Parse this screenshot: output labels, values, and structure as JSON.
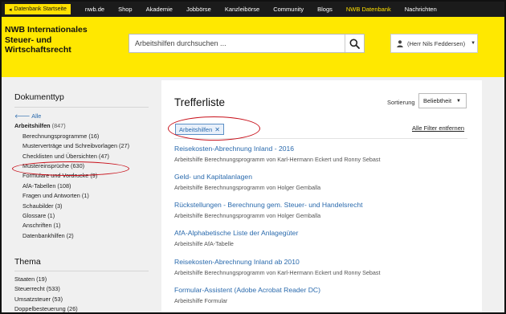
{
  "topnav": {
    "back_label": "Datenbank Startseite",
    "links": [
      {
        "label": "nwb.de",
        "active": false
      },
      {
        "label": "Shop",
        "active": false
      },
      {
        "label": "Akademie",
        "active": false
      },
      {
        "label": "Jobbörse",
        "active": false
      },
      {
        "label": "Kanzleibörse",
        "active": false
      },
      {
        "label": "Community",
        "active": false
      },
      {
        "label": "Blogs",
        "active": false
      },
      {
        "label": "NWB Datenbank",
        "active": true
      },
      {
        "label": "Nachrichten",
        "active": false
      }
    ]
  },
  "header": {
    "brand_line1": "NWB Internationales",
    "brand_line2": "Steuer- und",
    "brand_line3": "Wirtschaftsrecht",
    "search_placeholder": "Arbeitshilfen durchsuchen ...",
    "user_label": "(Herr Nils Feddersen)"
  },
  "sidebar": {
    "doc_title": "Dokumenttyp",
    "doc_items": [
      {
        "label": "Alle",
        "kind": "all"
      },
      {
        "label": "Arbeitshilfen",
        "count": "(847)",
        "kind": "bold"
      },
      {
        "label": "Berechnungsprogramme (16)",
        "kind": "sub"
      },
      {
        "label": "Musterverträge und Schreibvorlagen (27)",
        "kind": "sub"
      },
      {
        "label": "Checklisten und Übersichten (47)",
        "kind": "sub"
      },
      {
        "label": "Mustereinsprüche (630)",
        "kind": "sub"
      },
      {
        "label": "Formulare und Vordrucke (9)",
        "kind": "sub"
      },
      {
        "label": "AfA-Tabellen (108)",
        "kind": "sub"
      },
      {
        "label": "Fragen und Antworten (1)",
        "kind": "sub"
      },
      {
        "label": "Schaubilder (3)",
        "kind": "sub"
      },
      {
        "label": "Glossare (1)",
        "kind": "sub"
      },
      {
        "label": "Anschriften (1)",
        "kind": "sub"
      },
      {
        "label": "Datenbankhilfen (2)",
        "kind": "sub"
      }
    ],
    "thema_title": "Thema",
    "thema_items": [
      {
        "label": "Staaten (19)"
      },
      {
        "label": "Steuerrecht (533)"
      },
      {
        "label": "Umsatzsteuer (53)"
      },
      {
        "label": "Doppelbesteuerung (26)"
      }
    ]
  },
  "main": {
    "title": "Trefferliste",
    "sort_label": "Sortierung",
    "sort_value": "Beliebtheit",
    "filter_chip": "Arbeitshilfen",
    "remove_all": "Alle Filter entfernen",
    "results": [
      {
        "title": "Reisekosten-Abrechnung Inland - 2016",
        "sub": "Arbeitshilfe Berechnungsprogramm von Karl-Hermann Eckert und Ronny Sebast"
      },
      {
        "title": "Geld- und Kapitalanlagen",
        "sub": "Arbeitshilfe Berechnungsprogramm von Holger Gemballa"
      },
      {
        "title": "Rückstellungen - Berechnung gem. Steuer- und Handelsrecht",
        "sub": "Arbeitshilfe Berechnungsprogramm von Holger Gemballa"
      },
      {
        "title": "AfA-Alphabetische Liste der Anlagegüter",
        "sub": "Arbeitshilfe AfA-Tabelle"
      },
      {
        "title": "Reisekosten-Abrechnung Inland ab 2010",
        "sub": "Arbeitshilfe Berechnungsprogramm von Karl-Hermann Eckert und Ronny Sebast"
      },
      {
        "title": "Formular-Assistent (Adobe Acrobat Reader DC)",
        "sub": "Arbeitshilfe Formular"
      }
    ]
  },
  "colors": {
    "brand_yellow": "#ffe800",
    "nav_dark": "#1b1b1b",
    "link_blue": "#2a6aad",
    "annotation_red": "#c8101a"
  }
}
